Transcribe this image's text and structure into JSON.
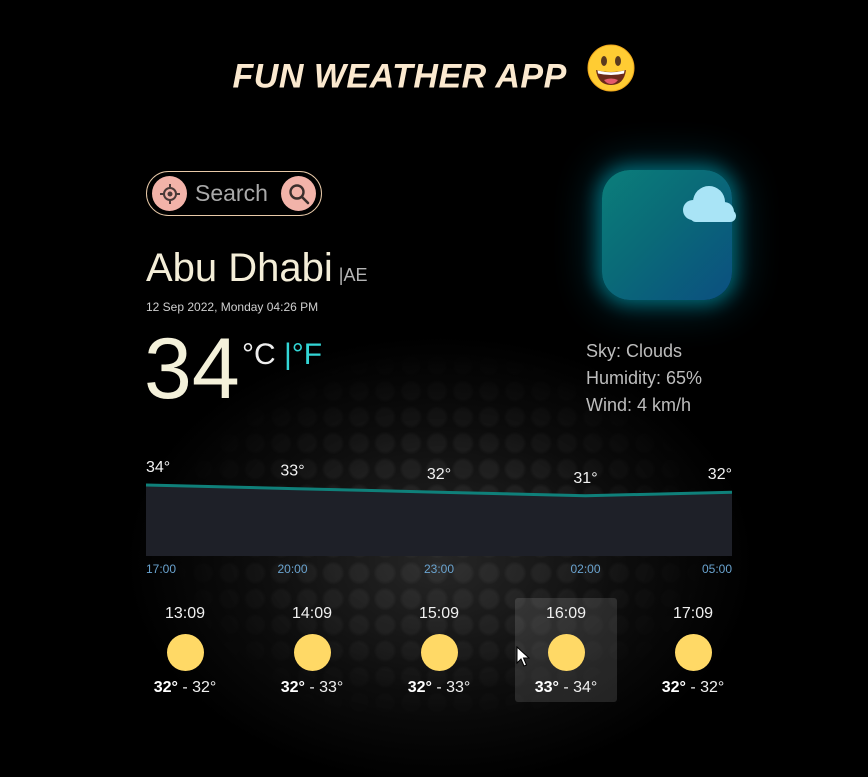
{
  "app": {
    "title": "FUN WEATHER APP",
    "emoji": "grinning-face"
  },
  "search": {
    "placeholder": "Search",
    "value": ""
  },
  "location": {
    "city": "Abu Dhabi",
    "country": "|AE",
    "datetime": "12 Sep 2022, Monday 04:26 PM"
  },
  "current": {
    "temp": "34",
    "unit_c": "°C",
    "unit_f": "|°F",
    "condition_icon": "cloud-icon",
    "sky": "Sky: Clouds",
    "humidity": "Humidity: 65%",
    "wind": "Wind: 4 km/h"
  },
  "colors": {
    "title": "#fbe9cf",
    "accent_f": "#33d6d6",
    "line": "#0f807a",
    "area": "#1e2028",
    "axis_label": "#6aa3cf",
    "sun": "#ffd966",
    "search_button": "#f2b3a9"
  },
  "chart_data": {
    "type": "area",
    "x": [
      "17:00",
      "20:00",
      "23:00",
      "02:00",
      "05:00"
    ],
    "values": [
      34,
      33,
      32,
      31,
      32
    ],
    "value_labels": [
      "34°",
      "33°",
      "32°",
      "31°",
      "32°"
    ],
    "ylim": [
      0,
      40
    ],
    "grid": false
  },
  "forecast": [
    {
      "time": "13:09",
      "icon": "sun-icon",
      "max": "32°",
      "min": "- 32°",
      "active": false
    },
    {
      "time": "14:09",
      "icon": "sun-icon",
      "max": "32°",
      "min": "- 33°",
      "active": false
    },
    {
      "time": "15:09",
      "icon": "sun-icon",
      "max": "32°",
      "min": "- 33°",
      "active": false
    },
    {
      "time": "16:09",
      "icon": "sun-icon",
      "max": "33°",
      "min": "- 34°",
      "active": true
    },
    {
      "time": "17:09",
      "icon": "sun-icon",
      "max": "32°",
      "min": "- 32°",
      "active": false
    }
  ]
}
